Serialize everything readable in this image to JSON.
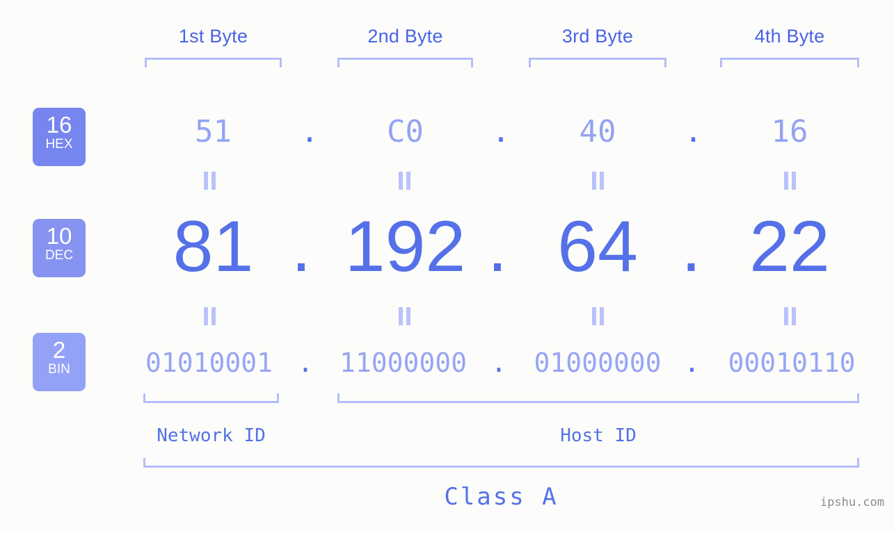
{
  "background_color": "#fcfdfa",
  "accent_colors": {
    "strong_blue": "#5570e8",
    "header_blue": "#4a62e8",
    "light_blue": "#95a3f3",
    "bracket_blue": "#b3bdfb",
    "badge_hex": "#7785ee",
    "badge_dec": "#8693f0",
    "badge_bin": "#93a2f6",
    "watermark_grey": "#8b8b8b"
  },
  "byte_headers": [
    {
      "label": "1st Byte"
    },
    {
      "label": "2nd Byte"
    },
    {
      "label": "3rd Byte"
    },
    {
      "label": "4th Byte"
    }
  ],
  "bases": [
    {
      "number": "16",
      "name": "HEX"
    },
    {
      "number": "10",
      "name": "DEC"
    },
    {
      "number": "2",
      "name": "BIN"
    }
  ],
  "rows": {
    "hex": {
      "base_number": "16",
      "base_name": "HEX",
      "values": [
        "51",
        "C0",
        "40",
        "16"
      ],
      "separator": "."
    },
    "dec": {
      "base_number": "10",
      "base_name": "DEC",
      "values": [
        "81",
        "192",
        "64",
        "22"
      ],
      "separator": "."
    },
    "bin": {
      "base_number": "2",
      "base_name": "BIN",
      "values": [
        "01010001",
        "11000000",
        "01000000",
        "00010110"
      ],
      "separator": "."
    }
  },
  "equality_marks": {
    "symbol": "=",
    "count_per_gap": 4
  },
  "segments": {
    "network_id": "Network ID",
    "host_id": "Host ID",
    "class": "Class A"
  },
  "watermark": "ipshu.com"
}
